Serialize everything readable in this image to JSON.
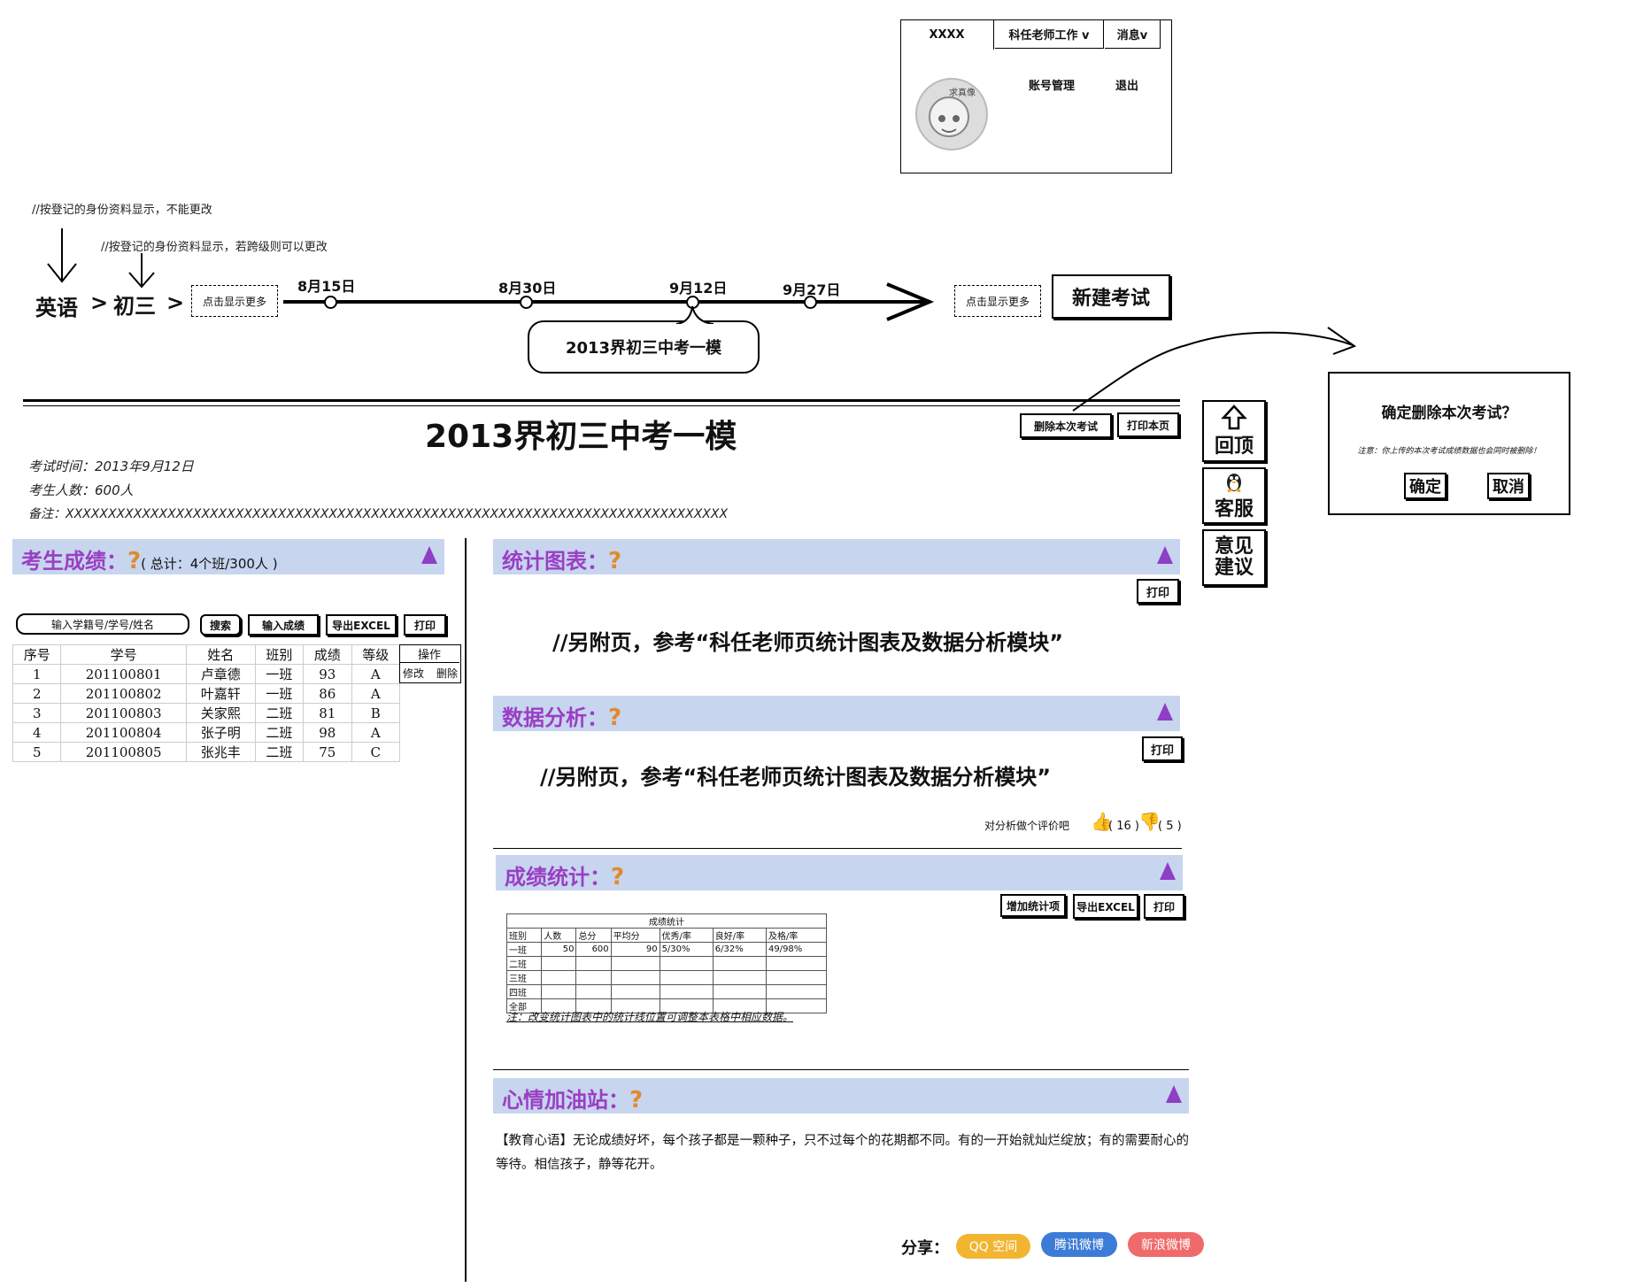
{
  "user_menu": {
    "tab_user": "XXXX",
    "tab_role": "科任老师工作 v",
    "tab_messages": "消息v",
    "avatar_caption": "求真像",
    "account_link": "账号管理",
    "logout_link": "退出"
  },
  "annotations": {
    "subject_note": "//按登记的身份资料显示，不能更改",
    "grade_note": "//按登记的身份资料显示，若跨级则可以更改"
  },
  "breadcrumb": {
    "subject": "英语",
    "sep1": ">",
    "grade": "初三",
    "sep2": ">",
    "more_left": "点击显示更多",
    "more_right": "点击显示更多"
  },
  "timeline": {
    "dates": [
      "8月15日",
      "8月30日",
      "9月12日",
      "9月27日"
    ],
    "selected_callout": "2013界初三中考一模"
  },
  "new_exam_button": "新建考试",
  "exam": {
    "title": "2013界初三中考一模",
    "delete_button": "删除本次考试",
    "print_page_button": "打印本页",
    "time": "考试时间：2013年9月12日",
    "count": "考生人数：600人",
    "remark": "备注：XXXXXXXXXXXXXXXXXXXXXXXXXXXXXXXXXXXXXXXXXXXXXXXXXXXXXXXXXXXXXXXXXXXXXXXXXXXXXX"
  },
  "side_nav": {
    "back_top": "回顶",
    "service": "客服",
    "feedback_line1": "意见",
    "feedback_line2": "建议"
  },
  "confirm_dialog": {
    "title": "确定删除本次考试？",
    "warning": "注意：你上传的本次考试成绩数据也会同时被删除！",
    "ok": "确定",
    "cancel": "取消"
  },
  "scores": {
    "title": "考生成绩：",
    "summary": "( 总计：4个班/300人 )",
    "search_placeholder": "输入学籍号/学号/姓名",
    "search_button": "搜索",
    "input_button": "输入成绩",
    "export_button": "导出EXCEL",
    "print_button": "打印",
    "columns": [
      "序号",
      "学号",
      "姓名",
      "班别",
      "成绩",
      "等级"
    ],
    "op_header": "操作",
    "op_edit": "修改",
    "op_delete": "删除",
    "rows": [
      [
        "1",
        "201100801",
        "卢章德",
        "一班",
        "93",
        "A"
      ],
      [
        "2",
        "201100802",
        "叶嘉轩",
        "一班",
        "86",
        "A"
      ],
      [
        "3",
        "201100803",
        "关家熙",
        "二班",
        "81",
        "B"
      ],
      [
        "4",
        "201100804",
        "张子明",
        "二班",
        "98",
        "A"
      ],
      [
        "5",
        "201100805",
        "张兆丰",
        "二班",
        "75",
        "C"
      ]
    ]
  },
  "charts_section": {
    "title": "统计图表：",
    "print": "打印",
    "ref": "//另附页，参考“科任老师页统计图表及数据分析模块”"
  },
  "analysis_section": {
    "title": "数据分析：",
    "print": "打印",
    "ref": "//另附页，参考“科任老师页统计图表及数据分析模块”",
    "rate_prompt": "对分析做个评价吧",
    "likes": "( 16 )",
    "dislikes": "( 5 )"
  },
  "stats_section": {
    "title": "成绩统计：",
    "add_button": "增加统计项",
    "export_button": "导出EXCEL",
    "print_button": "打印",
    "table_title": "成绩统计",
    "headers": [
      "班别",
      "人数",
      "总分",
      "平均分",
      "优秀/率",
      "良好/率",
      "及格/率"
    ],
    "rows": [
      [
        "一班",
        "50",
        "600",
        "90",
        "5/30%",
        "6/32%",
        "49/98%"
      ],
      [
        "二班",
        "",
        "",
        "",
        "",
        "",
        ""
      ],
      [
        "三班",
        "",
        "",
        "",
        "",
        "",
        ""
      ],
      [
        "四班",
        "",
        "",
        "",
        "",
        "",
        ""
      ],
      [
        "全部",
        "",
        "",
        "",
        "",
        "",
        ""
      ]
    ],
    "footnote": "注：改变统计图表中的统计线位置可调整本表格中相应数据。"
  },
  "mood_section": {
    "title": "心情加油站：",
    "text": "【教育心语】无论成绩好坏，每个孩子都是一颗种子，只不过每个的花期都不同。有的一开始就灿烂绽放；有的需要耐心的等待。相信孩子，静等花开。"
  },
  "share": {
    "label": "分享：",
    "qzone": "QQ 空间",
    "tencent": "腾讯微博",
    "sina": "新浪微博"
  },
  "colors": {
    "section_bar": "#c7d5ef",
    "section_title": "#9a3fc4",
    "question_mark": "#e08a2a",
    "qzone": "#f2b531",
    "tencent": "#3d7cd6",
    "sina": "#ef6b6b"
  }
}
